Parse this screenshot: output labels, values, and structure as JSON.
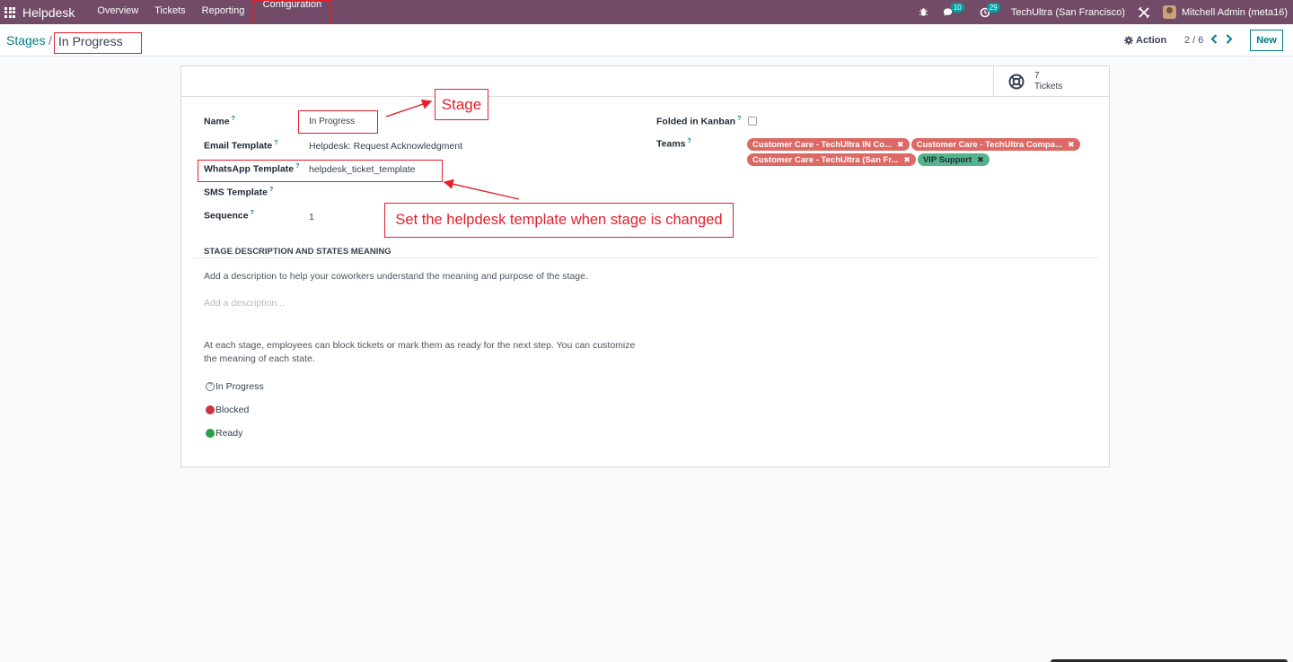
{
  "navbar": {
    "app_name": "Helpdesk",
    "menu": [
      "Overview",
      "Tickets",
      "Reporting",
      "Configuration"
    ],
    "messages_count": "10",
    "activities_count": "29",
    "company": "TechUltra (San Francisco)",
    "user": "Mitchell Admin (meta16)"
  },
  "breadcrumb": {
    "parent": "Stages",
    "separator": "/",
    "current": "In Progress"
  },
  "control": {
    "action_label": "Action",
    "pager": "2 / 6",
    "new_label": "New"
  },
  "stat_button": {
    "count": "7",
    "label": "Tickets"
  },
  "form": {
    "name_label": "Name",
    "name_value": "In Progress",
    "email_template_label": "Email Template",
    "email_template_value": "Helpdesk: Request Acknowledgment",
    "whatsapp_template_label": "WhatsApp Template",
    "whatsapp_template_value": "helpdesk_ticket_template",
    "sms_template_label": "SMS Template",
    "sequence_label": "Sequence",
    "sequence_value": "1",
    "folded_label": "Folded in Kanban",
    "teams_label": "Teams",
    "help_mark": "?"
  },
  "teams": [
    {
      "name": "Customer Care - TechUltra IN Co...",
      "color": "#dc6965"
    },
    {
      "name": "Customer Care - TechUltra Compa...",
      "color": "#dc6965"
    },
    {
      "name": "Customer Care - TechUltra (San Fr...",
      "color": "#dc6965"
    },
    {
      "name": "VIP Support",
      "color": "#55b48b"
    }
  ],
  "description": {
    "section_title": "STAGE DESCRIPTION AND STATES MEANING",
    "intro": "Add a description to help your coworkers understand the meaning and purpose of the stage.",
    "placeholder": "Add a description...",
    "states_line1": "At each stage, employees can block tickets or mark them as ready for the next step. You can customize",
    "states_line2": "the meaning of each state."
  },
  "states": [
    {
      "label": "In Progress",
      "color": "grey"
    },
    {
      "label": "Blocked",
      "color": "#c9363e"
    },
    {
      "label": "Ready",
      "color": "#2ea04a"
    }
  ],
  "annotations": {
    "stage": "Stage",
    "template_note": "Set the helpdesk template when stage is changed",
    "color": "#e3202b"
  },
  "colors": {
    "brand": "#714b67",
    "accent": "#017e84"
  }
}
